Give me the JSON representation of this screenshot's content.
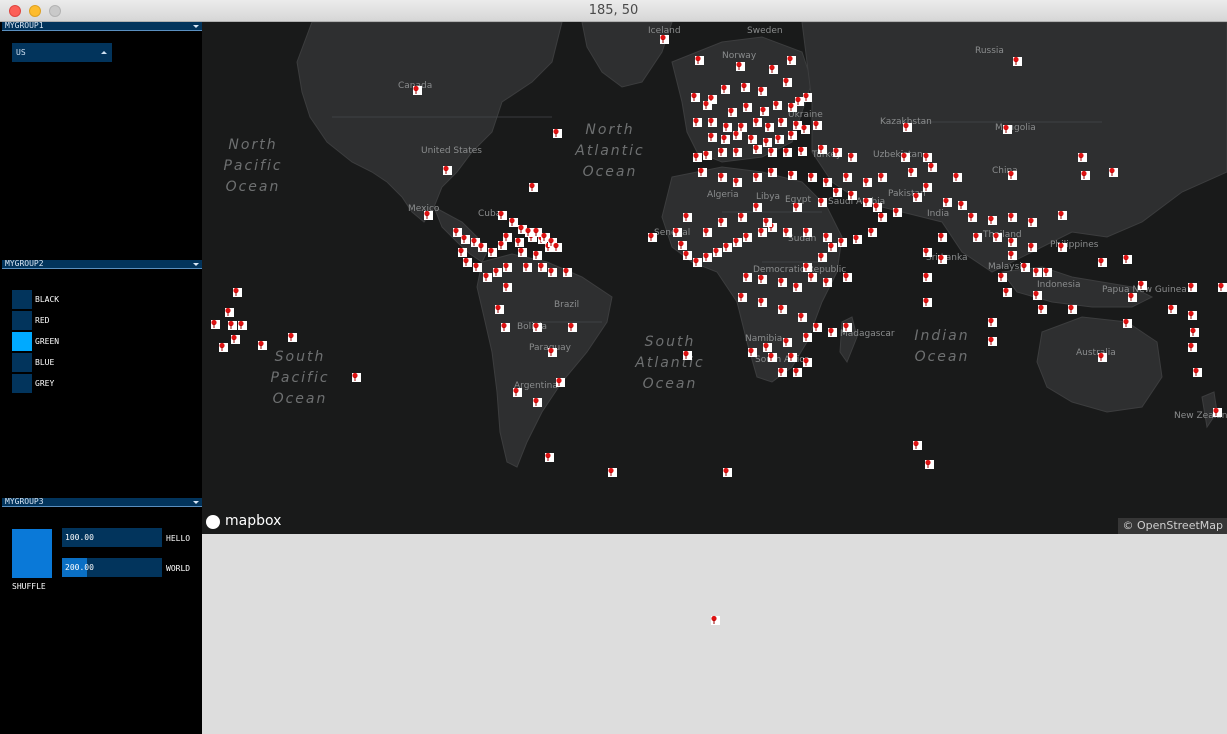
{
  "window": {
    "title": "185, 50"
  },
  "sidebar": {
    "group1": {
      "label": "MYGROUP1",
      "dropdown": {
        "selected": "US"
      }
    },
    "group2": {
      "label": "MYGROUP2",
      "options": [
        {
          "label": "BLACK",
          "active": false
        },
        {
          "label": "RED",
          "active": false
        },
        {
          "label": "GREEN",
          "active": true
        },
        {
          "label": "BLUE",
          "active": false
        },
        {
          "label": "GREY",
          "active": false
        }
      ]
    },
    "group3": {
      "label": "MYGROUP3",
      "button_label": "SHUFFLE",
      "sliders": [
        {
          "value": "100.00",
          "label": "HELLO",
          "fill_fraction": 0.0
        },
        {
          "value": "200.00",
          "label": "WORLD",
          "fill_fraction": 0.25
        }
      ]
    }
  },
  "map": {
    "oceans": {
      "north_pacific": "North Pacific Ocean",
      "south_pacific": "South Pacific Ocean",
      "north_atlantic": "North Atlantic Ocean",
      "south_atlantic": "South Atlantic Ocean",
      "indian": "Indian Ocean"
    },
    "labels": {
      "iceland": "Iceland",
      "sweden": "Sweden",
      "norway": "Norway",
      "russia": "Russia",
      "canada": "Canada",
      "united_states": "United States",
      "mexico": "Mexico",
      "cuba": "Cuba",
      "brazil": "Brazil",
      "bolivia": "Bolivia",
      "paraguay": "Paraguay",
      "argentina": "Argentina",
      "kazakhstan": "Kazakhstan",
      "mongolia": "Mongolia",
      "china": "China",
      "india": "India",
      "thailand": "Thailand",
      "philippines": "Philippines",
      "malaysia": "Malaysia",
      "indonesia": "Indonesia",
      "papua_new_guinea": "Papua New Guinea",
      "australia": "Australia",
      "new_zealand": "New Zealand",
      "turkey": "Turkey",
      "uzbekistan": "Uzbekistan",
      "pakistan": "Pakistan",
      "sri_lanka": "Sri Lanka",
      "saudi_arabia": "Saudi Arabia",
      "egypt": "Egypt",
      "sudan": "Sudan",
      "libya": "Libya",
      "algeria": "Algeria",
      "senegal": "Senegal",
      "ukraine": "Ukraine",
      "madagascar": "Madagascar",
      "namibia": "Namibia",
      "south_africa": "South Africa",
      "dem_republic": "Democratic Republic"
    },
    "logo_text": "mapbox",
    "attribution": "© OpenStreetMap",
    "marker_count_visible": "many"
  }
}
